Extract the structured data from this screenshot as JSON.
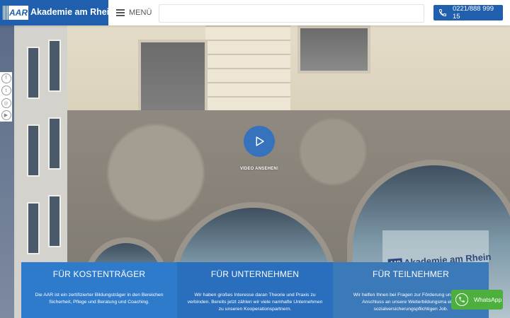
{
  "header": {
    "logo_mark": "AAR",
    "logo_name": "Akademie am Rhein",
    "menu_label": "MENÜ",
    "search_placeholder": "",
    "phone_number": "0221/888 999 15",
    "accent_color": "#1f5fad"
  },
  "social": [
    {
      "icon": "facebook-icon",
      "glyph": "f"
    },
    {
      "icon": "twitter-icon",
      "glyph": "t"
    },
    {
      "icon": "instagram-icon",
      "glyph": "◎"
    },
    {
      "icon": "youtube-icon",
      "glyph": "▶"
    }
  ],
  "hero": {
    "video_label": "VIDEO ANSEHEN!",
    "sign_text": "Akademie am Rhein",
    "sign_logo": "AAR"
  },
  "cards": [
    {
      "title": "FÜR KOSTENTRÄGER",
      "text": "Die AAR ist ein zertifizierter Bildungsträger in den Bereichen Sicherheit, Pflege und Beratung und Coaching."
    },
    {
      "title": "FÜR UNTERNEHMEN",
      "text": "Wir haben großes Interesse daran Theorie und Praxis zu verbinden. Bereits jetzt zählen wir viele namhafte Unternehmen zu unseren Kooperationspartnern."
    },
    {
      "title": "FÜR TEILNEHMER",
      "text": "Wir helfen Ihnen bei Fragen zur Förderung und Sie im Anschluss an unsere Weiterbildungsma einen sozialversicherungspflichtigen Job."
    }
  ],
  "whatsapp": {
    "label": "WhatsApp",
    "color": "#4caf3e"
  }
}
